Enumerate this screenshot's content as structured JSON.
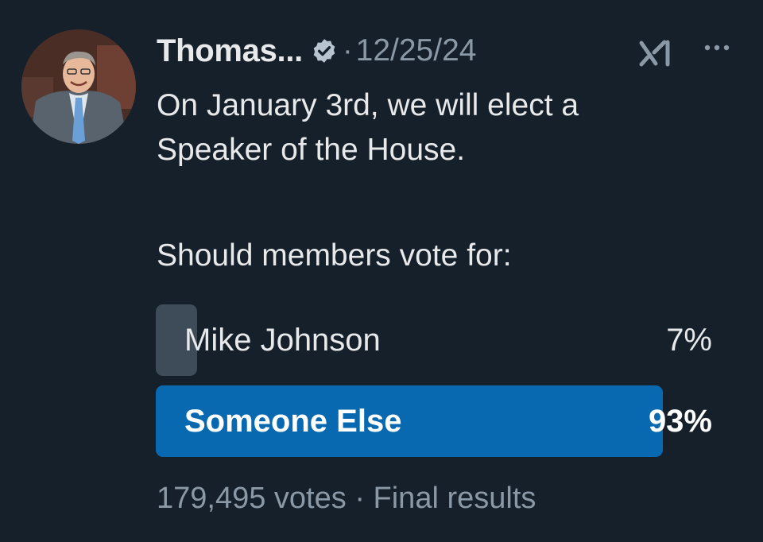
{
  "tweet": {
    "author_name": "Thomas...",
    "verified_icon": "verified-badge-icon",
    "separator": "·",
    "date": "12/25/24",
    "body_line1": "On January 3rd, we will elect a",
    "body_line2": "Speaker of the House.",
    "body_line3": "Should members vote for:"
  },
  "poll": {
    "options": [
      {
        "label": "Mike Johnson",
        "percent_label": "7%",
        "percent": 7,
        "winner": false
      },
      {
        "label": "Someone Else",
        "percent_label": "93%",
        "percent": 93,
        "winner": true
      }
    ],
    "votes": "179,495 votes",
    "separator": "·",
    "status": "Final results"
  },
  "icons": {
    "grok": "grok-icon",
    "more": "more-options-icon"
  },
  "colors": {
    "background": "#15202b",
    "winner_bar": "#0869b0",
    "loser_bar": "#3e4b58",
    "verified": "#b8c4cf"
  }
}
